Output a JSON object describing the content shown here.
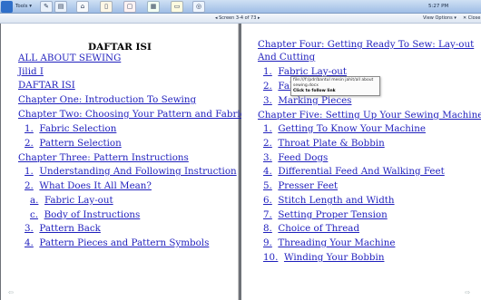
{
  "taskbar": {
    "tools_label": "Tools ▾",
    "screen_counter": "◂ Screen 3-4 of 73 ▸",
    "view_options": "View Options ▾",
    "close_label": "✕ Close",
    "time": "5:27 PM"
  },
  "left_page": {
    "title": "DAFTAR ISI",
    "lines": [
      {
        "num": "",
        "text": "ALL ABOUT SEWING"
      },
      {
        "num": "",
        "text": "Jilid I"
      },
      {
        "num": "",
        "text": "DAFTAR ISI"
      },
      {
        "num": "",
        "text": "Chapter One: Introduction To Sewing"
      },
      {
        "num": "",
        "text": "Chapter Two: Choosing Your Pattern and Fabric"
      },
      {
        "num": "1.",
        "text": "Fabric Selection"
      },
      {
        "num": "2.",
        "text": "Pattern Selection"
      },
      {
        "num": "",
        "text": "Chapter Three: Pattern Instructions"
      },
      {
        "num": "1.",
        "text": "Understanding And Following Instruction"
      },
      {
        "num": "2.",
        "text": "What Does It All Mean?"
      },
      {
        "num": "a.",
        "text": "Fabric Lay-out"
      },
      {
        "num": "c.",
        "text": "Body of Instructions"
      },
      {
        "num": "3.",
        "text": "Pattern Back"
      },
      {
        "num": "4.",
        "text": "Pattern Pieces and Pattern Symbols"
      }
    ]
  },
  "right_page": {
    "lines": [
      {
        "num": "",
        "text": "Chapter Four: Getting Ready To Sew: Lay-out"
      },
      {
        "num": "",
        "text": "And Cutting"
      },
      {
        "num": "1.",
        "text": "Fabric Lay-out"
      },
      {
        "num": "2.",
        "text": "Fabric"
      },
      {
        "num": "3.",
        "text": "Marking Pieces"
      },
      {
        "num": "",
        "text": "Chapter Five: Setting Up Your Sewing Machine"
      },
      {
        "num": "1.",
        "text": "Getting To Know Your Machine"
      },
      {
        "num": "2.",
        "text": "Throat Plate & Bobbin"
      },
      {
        "num": "3.",
        "text": "Feed Dogs"
      },
      {
        "num": "4.",
        "text": "Differential Feed And Walking Feet"
      },
      {
        "num": "5.",
        "text": "Presser Feet"
      },
      {
        "num": "6.",
        "text": "Stitch Length and Width"
      },
      {
        "num": "7.",
        "text": "Setting Proper Tension"
      },
      {
        "num": "8.",
        "text": "Choice of Thread"
      },
      {
        "num": "9.",
        "text": "Threading Your Machine"
      },
      {
        "num": "10.",
        "text": "Winding Your Bobbin"
      }
    ]
  },
  "tooltip": {
    "line1": "file:///f:/pdr/bantul mesin jahit/all about sewing.docx",
    "line2": "Click to follow link"
  }
}
